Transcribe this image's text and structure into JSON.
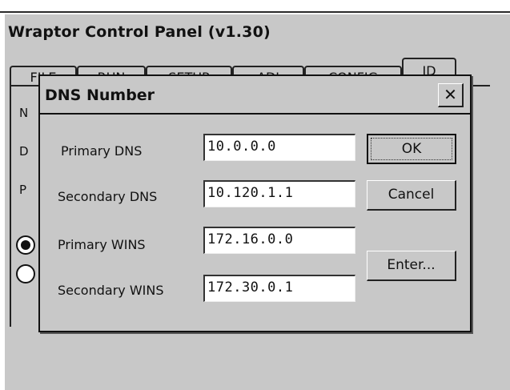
{
  "window": {
    "title": "Wraptor Control Panel (v1.30)"
  },
  "tabs": [
    {
      "label": "FILE",
      "active": false
    },
    {
      "label": "RUN",
      "active": false
    },
    {
      "label": "SETUP",
      "active": false
    },
    {
      "label": "ADJ",
      "active": false
    },
    {
      "label": "CONFIG",
      "active": false
    },
    {
      "label": "ID",
      "active": true
    }
  ],
  "background": {
    "label_1": "N",
    "label_2": "D",
    "label_3": "P"
  },
  "dialog": {
    "title": "DNS Number",
    "close_glyph": "✕",
    "fields": [
      {
        "label": "Primary DNS",
        "value": "10.0.0.0"
      },
      {
        "label": "Secondary DNS",
        "value": "10.120.1.1"
      },
      {
        "label": "Primary WINS",
        "value": "172.16.0.0"
      },
      {
        "label": "Secondary WINS",
        "value": "172.30.0.1"
      }
    ],
    "buttons": {
      "ok": "OK",
      "cancel": "Cancel",
      "enter": "Enter..."
    }
  }
}
